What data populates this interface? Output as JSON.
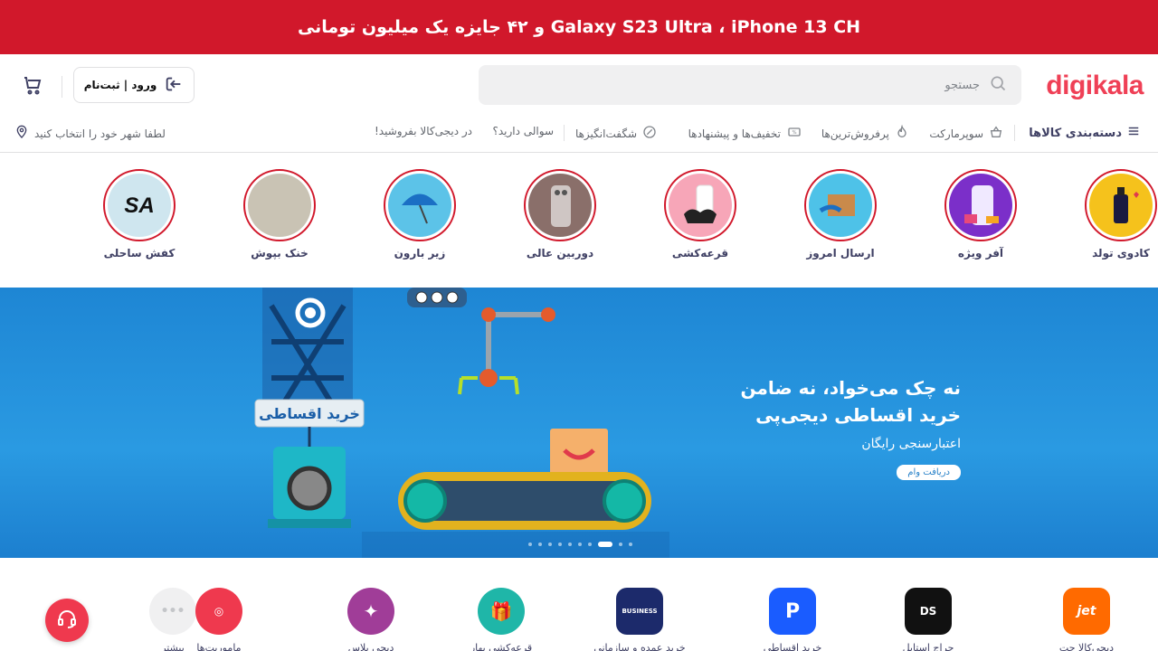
{
  "promo": {
    "text": "Galaxy S23 Ultra  ،  iPhone 13 CH  و ۴۲ جایزه یک میلیون تومانی"
  },
  "header": {
    "logo": "digikala",
    "search_placeholder": "جستجو",
    "login_label": "ورود | ثبت‌نام"
  },
  "nav": {
    "categories": "دسته‌بندی کالاها",
    "supermarket": "سوپرمارکت",
    "bestsellers": "پرفروش‌ترین‌ها",
    "deals": "تخفیف‌ها و پیشنهادها",
    "amazing": "شگفت‌انگیزها",
    "questions": "سوالی دارید؟",
    "sell": "در دیجی‌کالا بفروشید!",
    "city": "لطفا شهر خود را انتخاب کنید"
  },
  "stories": [
    {
      "label": "کادوی تولد",
      "color": "#f5c21c"
    },
    {
      "label": "آفر ویژه",
      "color": "#7b2fc9"
    },
    {
      "label": "ارسال امروز",
      "color": "#4ec2e8"
    },
    {
      "label": "قرعه‌کشی",
      "color": "#f7a6b8"
    },
    {
      "label": "دوربین عالی",
      "color": "#8a6f6a"
    },
    {
      "label": "زیر بارون",
      "color": "#5cc3e8"
    },
    {
      "label": "خنک بپوش",
      "color": "#c9c3b4"
    },
    {
      "label": "کفش ساحلی",
      "color": "#cfe6ef"
    }
  ],
  "hero": {
    "line1": "نه چک می‌خواد، نه ضامن",
    "line2": "خرید اقساطی دیجی‌پی",
    "line3": "اعتبارسنجی رایگان",
    "button": "دریافت وام",
    "sign": "خرید اقساطی",
    "active_slide": 2,
    "slide_count": 10
  },
  "services": [
    {
      "label": "دیجی‌کالا جت",
      "color": "#ff6a00",
      "glyph": "jet"
    },
    {
      "label": "حراج استایل",
      "color": "#111111",
      "glyph": "DS"
    },
    {
      "label": "خرید اقساطی",
      "color": "#1a5cff",
      "glyph": "P"
    },
    {
      "label": "خرید عمده و سازمانی",
      "color": "#1c2a6b",
      "glyph": "BUSINESS"
    },
    {
      "label": "قرعه‌کشی بهار",
      "color": "#1fb6a8",
      "glyph": "🎁"
    },
    {
      "label": "دیجی پلاس",
      "color": "#a03d98",
      "glyph": "✦"
    },
    {
      "label": "ماموریت‌ها",
      "color": "#ef394e",
      "glyph": "◎"
    },
    {
      "label": "بیشتر",
      "color": "#f0f0f1",
      "glyph": "•••"
    }
  ]
}
